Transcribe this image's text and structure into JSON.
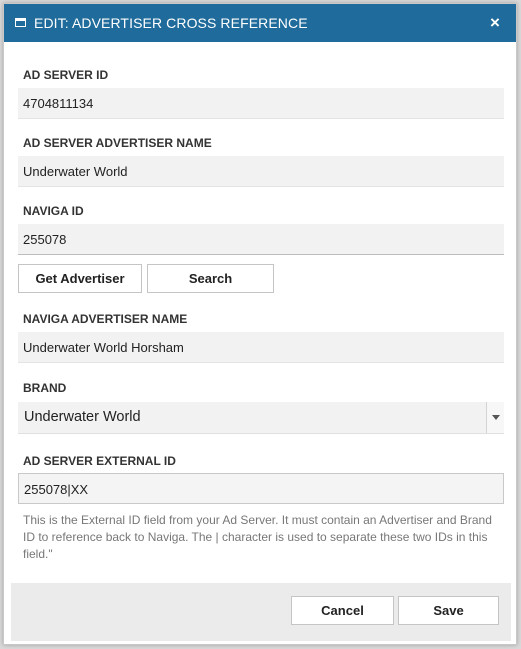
{
  "dialog": {
    "title": "EDIT: ADVERTISER CROSS REFERENCE",
    "close_label": "×",
    "accent_color": "#1f6b9b"
  },
  "fields": {
    "ad_server_id": {
      "label": "AD SERVER ID",
      "value": "4704811134"
    },
    "ad_server_advertiser_name": {
      "label": "AD SERVER ADVERTISER NAME",
      "value": "Underwater World"
    },
    "naviga_id": {
      "label": "NAVIGA ID",
      "value": "255078"
    },
    "naviga_advertiser_name": {
      "label": "NAVIGA ADVERTISER NAME",
      "value": "Underwater World Horsham"
    },
    "brand": {
      "label": "BRAND",
      "value": "Underwater World"
    },
    "ad_server_external_id": {
      "label": "AD SERVER EXTERNAL ID",
      "value": "255078|XX",
      "help": "This is the External ID field from your Ad Server. It must contain an Advertiser and Brand ID to reference back to Naviga. The | character is used to separate these two IDs in this field.\""
    }
  },
  "buttons": {
    "get_advertiser": "Get Advertiser",
    "search": "Search",
    "cancel": "Cancel",
    "save": "Save"
  },
  "icons": {
    "title": "window-icon",
    "close": "close-icon",
    "dropdown": "chevron-down-icon"
  }
}
